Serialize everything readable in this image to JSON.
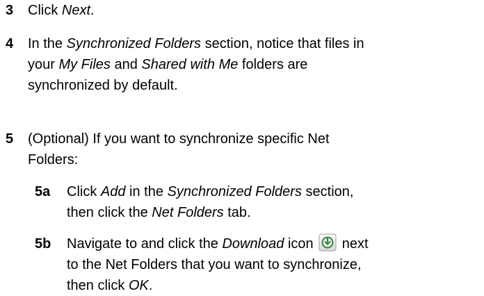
{
  "steps": {
    "s3": {
      "number": "3",
      "t1": "Click ",
      "i1": "Next",
      "t2": "."
    },
    "s4": {
      "number": "4",
      "line1_a": "In the ",
      "line1_i": "Synchronized Folders",
      "line1_b": " section, notice that files in",
      "line2_a": "your ",
      "line2_i1": "My Files",
      "line2_b": " and ",
      "line2_i2": "Shared with Me",
      "line2_c": " folders are",
      "line3": "synchronized by default."
    },
    "s5": {
      "number": "5",
      "line1": "(Optional) If you want to synchronize specific Net",
      "line2": "Folders:"
    },
    "s5a": {
      "number": "5a",
      "line1_a": "Click ",
      "line1_i1": "Add",
      "line1_b": " in the ",
      "line1_i2": "Synchronized Folders",
      "line1_c": " section,",
      "line2_a": "then click the ",
      "line2_i": "Net Folders",
      "line2_b": " tab."
    },
    "s5b": {
      "number": "5b",
      "line1_a": "Navigate to and click the ",
      "line1_i": "Download",
      "line1_b": " icon",
      "line1_c": " next",
      "line2": "to the Net Folders that you want to synchronize,",
      "line3_a": "then click ",
      "line3_i": "OK",
      "line3_b": "."
    }
  },
  "icons": {
    "download": "download-icon"
  },
  "colors": {
    "text": "#000000",
    "icon_border": "#9a9a9a",
    "icon_fill": "#e6e6e6",
    "icon_glyph": "#2d8a3a"
  }
}
